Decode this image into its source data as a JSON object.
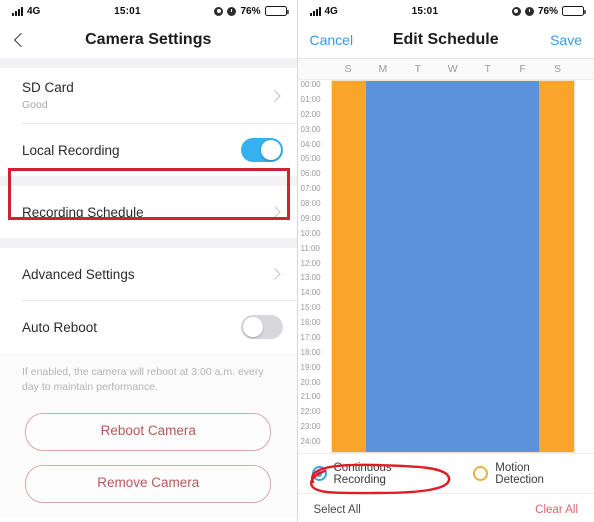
{
  "status_bar": {
    "network": "4G",
    "time": "15:01",
    "battery_pct": "76%",
    "icons": [
      "signal-bars-icon",
      "location-arrow-icon",
      "alarm-clock-icon",
      "battery-icon"
    ]
  },
  "left_panel": {
    "nav": {
      "back_icon": "chevron-left-icon",
      "title": "Camera Settings"
    },
    "rows": [
      {
        "title": "SD Card",
        "subtitle": "Good",
        "accessory": "chevron"
      },
      {
        "title": "Local Recording",
        "subtitle": "",
        "accessory": "toggle-on"
      },
      {
        "title": "Recording Schedule",
        "subtitle": "",
        "accessory": "chevron"
      },
      {
        "title": "Advanced Settings",
        "subtitle": "",
        "accessory": "chevron"
      },
      {
        "title": "Auto Reboot",
        "subtitle": "",
        "accessory": "toggle-off"
      }
    ],
    "footnote": "If enabled, the camera will reboot at 3:00 a.m. every day to maintain performance.",
    "buttons": [
      {
        "label": "Reboot Camera"
      },
      {
        "label": "Remove Camera"
      }
    ],
    "annotation": {
      "type": "red-rectangle",
      "targets": "Recording Schedule",
      "color": "#cf2233"
    }
  },
  "right_panel": {
    "nav": {
      "cancel_label": "Cancel",
      "title": "Edit Schedule",
      "save_label": "Save"
    },
    "days": [
      "S",
      "M",
      "T",
      "W",
      "T",
      "F",
      "S"
    ],
    "times": [
      "00:00",
      "01:00",
      "02:00",
      "03:00",
      "04:00",
      "05:00",
      "06:00",
      "07:00",
      "08:00",
      "09:00",
      "10:00",
      "11:00",
      "12:00",
      "13:00",
      "14:00",
      "15:00",
      "16:00",
      "17:00",
      "18:00",
      "19:00",
      "20:00",
      "21:00",
      "22:00",
      "23:00",
      "24:00"
    ],
    "legend": [
      {
        "label": "Continuous Recording",
        "color": "#34a6e8",
        "selected": true
      },
      {
        "label": "Motion Detection",
        "color": "#e8b13c",
        "selected": false
      }
    ],
    "actions": {
      "select_all": "Select All",
      "clear_all": "Clear All"
    },
    "annotation": {
      "type": "red-ellipse",
      "targets": "Continuous Recording",
      "color": "#e01b24"
    }
  },
  "chart_data": {
    "type": "heatmap",
    "title": "Edit Schedule",
    "xlabel": "",
    "ylabel": "",
    "categories": [
      "S",
      "M",
      "T",
      "W",
      "T",
      "F",
      "S"
    ],
    "y_ticks": [
      "00:00",
      "01:00",
      "02:00",
      "03:00",
      "04:00",
      "05:00",
      "06:00",
      "07:00",
      "08:00",
      "09:00",
      "10:00",
      "11:00",
      "12:00",
      "13:00",
      "14:00",
      "15:00",
      "16:00",
      "17:00",
      "18:00",
      "19:00",
      "20:00",
      "21:00",
      "22:00",
      "23:00",
      "24:00"
    ],
    "legend": [
      {
        "name": "Continuous Recording",
        "color": "#5b93db"
      },
      {
        "name": "Motion Detection",
        "color": "#f9a52b"
      }
    ],
    "columns": [
      {
        "day": "S",
        "mode": "Motion Detection",
        "color": "#f9a52b",
        "from": "00:00",
        "to": "24:00"
      },
      {
        "day": "M",
        "mode": "Continuous Recording",
        "color": "#5b93db",
        "from": "00:00",
        "to": "24:00"
      },
      {
        "day": "T",
        "mode": "Continuous Recording",
        "color": "#5b93db",
        "from": "00:00",
        "to": "24:00"
      },
      {
        "day": "W",
        "mode": "Continuous Recording",
        "color": "#5b93db",
        "from": "00:00",
        "to": "24:00"
      },
      {
        "day": "T",
        "mode": "Continuous Recording",
        "color": "#5b93db",
        "from": "00:00",
        "to": "24:00"
      },
      {
        "day": "F",
        "mode": "Continuous Recording",
        "color": "#5b93db",
        "from": "00:00",
        "to": "24:00"
      },
      {
        "day": "S",
        "mode": "Motion Detection",
        "color": "#f9a52b",
        "from": "00:00",
        "to": "24:00"
      }
    ]
  }
}
